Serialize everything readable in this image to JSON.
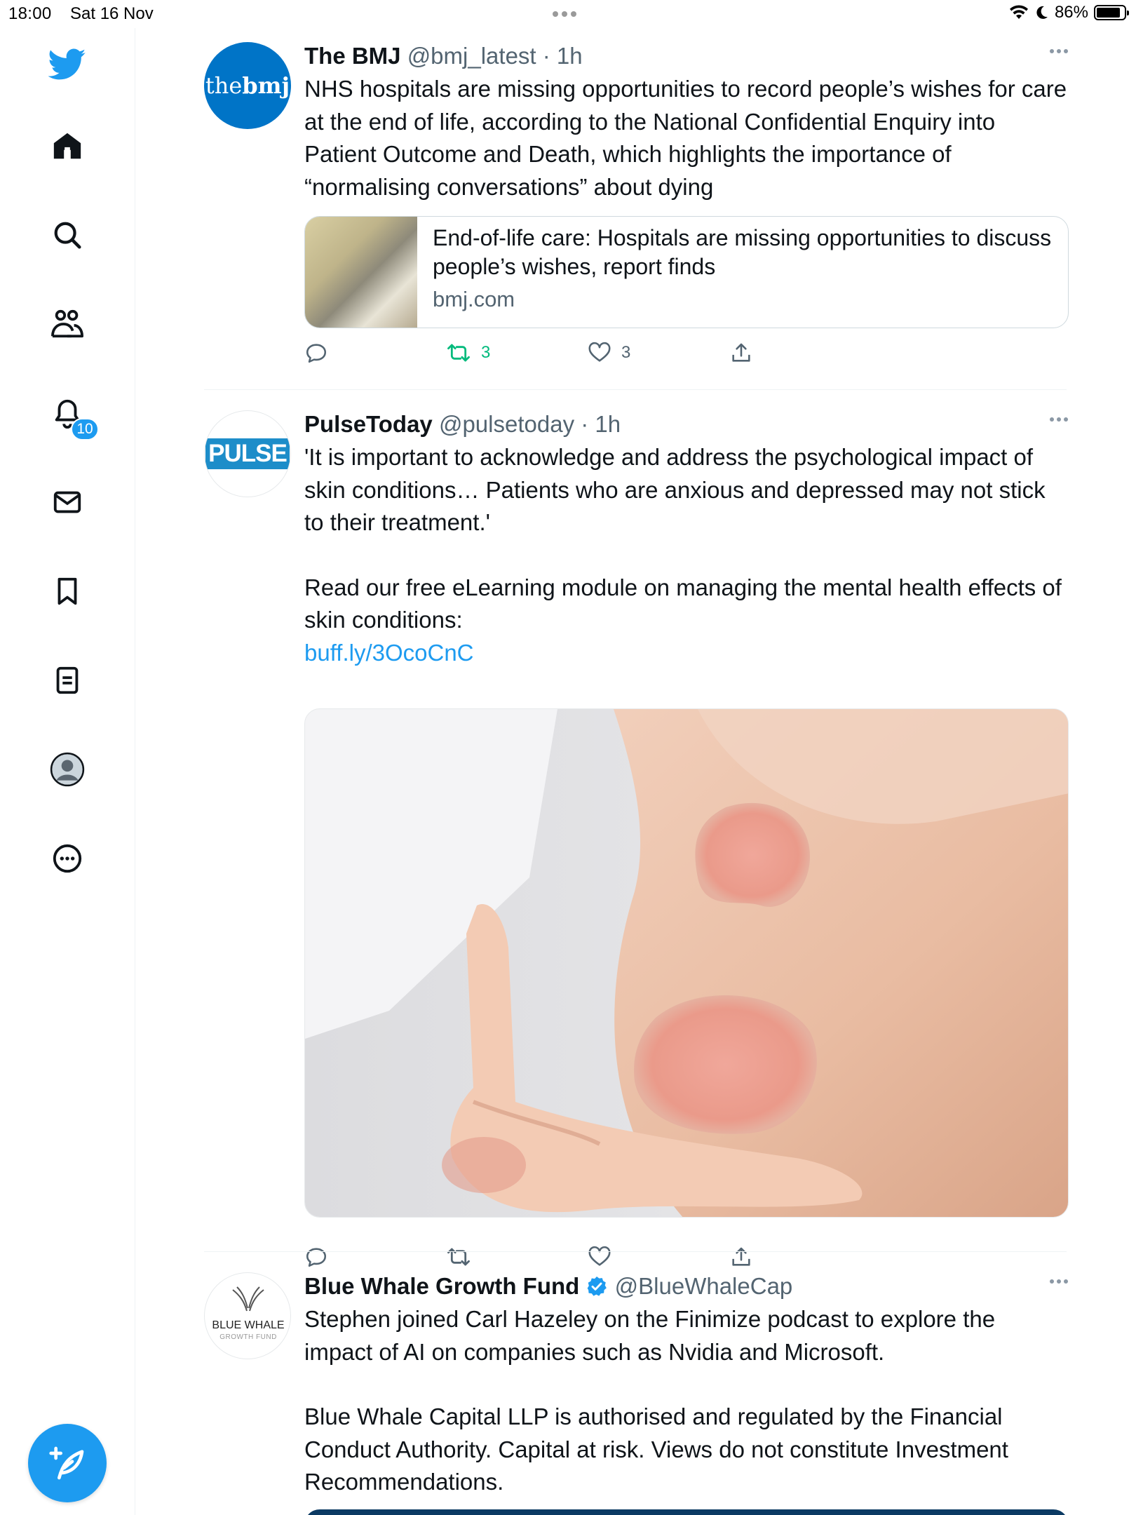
{
  "status_bar": {
    "time": "18:00",
    "date": "Sat 16 Nov",
    "battery": "86%",
    "battery_level": 0.86
  },
  "sidebar": {
    "items": [
      {
        "icon": "twitter-bird-icon"
      },
      {
        "icon": "home-icon"
      },
      {
        "icon": "search-icon"
      },
      {
        "icon": "communities-icon"
      },
      {
        "icon": "notifications-bell-icon",
        "badge": "10"
      },
      {
        "icon": "messages-icon"
      },
      {
        "icon": "bookmarks-icon"
      },
      {
        "icon": "lists-icon"
      },
      {
        "icon": "profile-avatar-icon"
      },
      {
        "icon": "more-circle-icon"
      }
    ],
    "compose": {
      "icon": "compose-tweet-icon"
    }
  },
  "colors": {
    "accent": "#1d9bf0",
    "retweet_active": "#00ba7c",
    "secondary_text": "#536471",
    "border": "#eff3f4"
  },
  "tweets": [
    {
      "author": "The BMJ",
      "handle": "@bmj_latest",
      "time": "· 1h",
      "avatar_text": {
        "light": "the",
        "bold": "bmj"
      },
      "text": "NHS hospitals are missing opportunities to record people’s wishes for care at the end of life, according to the National Confidential Enquiry into Patient Outcome and Death, which highlights the importance of “normalising conversations” about dying",
      "card": {
        "title": "End-of-life care: Hospitals are missing opportunities to discuss people’s wishes, report finds",
        "domain": "bmj.com"
      },
      "retweets": "3",
      "likes": "3"
    },
    {
      "author": "PulseToday",
      "handle": "@pulsetoday",
      "time": "· 1h",
      "avatar_text": "PULSE",
      "text_1": "'It is important to acknowledge and address the psychological impact of skin conditions… Patients who are anxious and depressed may not stick to their treatment.'",
      "text_2": "Read our free eLearning module on managing the mental health effects of skin conditions:",
      "link": "buff.ly/3OcoCnC"
    },
    {
      "author": "Blue Whale Growth Fund",
      "handle": "@BlueWhaleCap",
      "verified": true,
      "avatar_text": {
        "line1": "BLUE WHALE",
        "line2": "GROWTH FUND"
      },
      "text_1": "Stephen joined Carl Hazeley on the Finimize podcast to explore the impact of AI on companies such as Nvidia and Microsoft.",
      "text_2": "Blue Whale Capital LLP is authorised and regulated by the Financial Conduct Authority. Capital at risk. Views do not constitute Investment Recommendations."
    }
  ]
}
